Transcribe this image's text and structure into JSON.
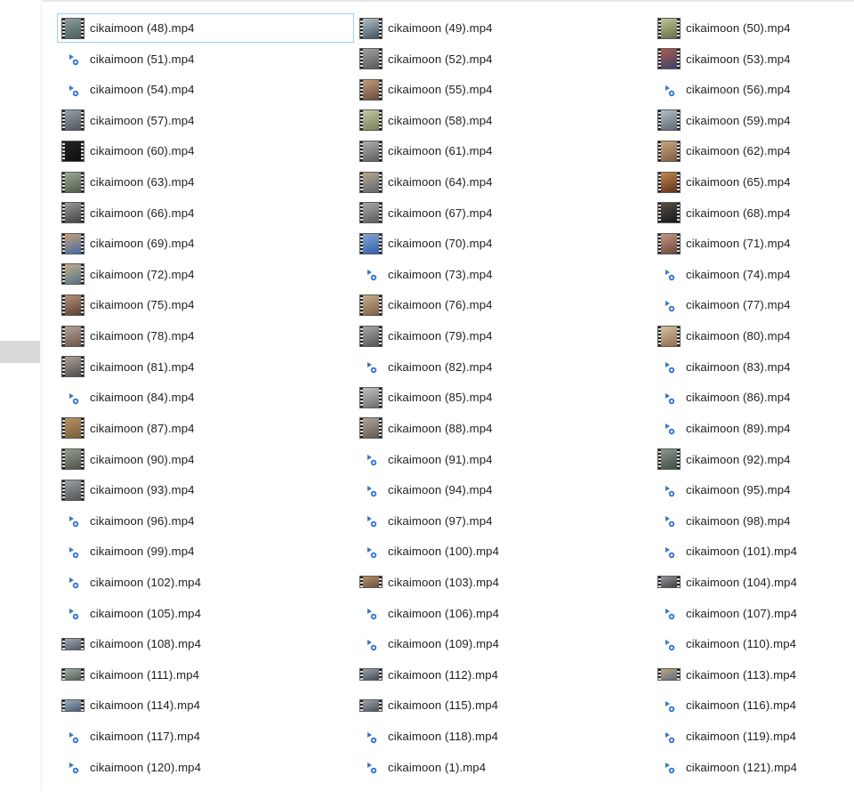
{
  "files": [
    {
      "name": "cikaimoon (48).mp4",
      "thumb": "image",
      "colors": [
        "#4a5a52",
        "#8fa0a8"
      ],
      "selected": true
    },
    {
      "name": "cikaimoon (49).mp4",
      "thumb": "image",
      "colors": [
        "#3d4e5c",
        "#b7c3c9"
      ]
    },
    {
      "name": "cikaimoon (50).mp4",
      "thumb": "image",
      "colors": [
        "#5d6b3f",
        "#c7c79a"
      ]
    },
    {
      "name": "cikaimoon (51).mp4",
      "thumb": "video-icon"
    },
    {
      "name": "cikaimoon (52).mp4",
      "thumb": "image",
      "colors": [
        "#55585b",
        "#a2a4a6"
      ]
    },
    {
      "name": "cikaimoon (53).mp4",
      "thumb": "image",
      "colors": [
        "#34446e",
        "#b05a4c"
      ]
    },
    {
      "name": "cikaimoon (54).mp4",
      "thumb": "video-icon"
    },
    {
      "name": "cikaimoon (55).mp4",
      "thumb": "image",
      "colors": [
        "#6a4a3a",
        "#c29c7d"
      ]
    },
    {
      "name": "cikaimoon (56).mp4",
      "thumb": "video-icon"
    },
    {
      "name": "cikaimoon (57).mp4",
      "thumb": "image",
      "colors": [
        "#4d5359",
        "#9aa3ab"
      ]
    },
    {
      "name": "cikaimoon (58).mp4",
      "thumb": "image",
      "colors": [
        "#76805a",
        "#c4c9a4"
      ]
    },
    {
      "name": "cikaimoon (59).mp4",
      "thumb": "image",
      "colors": [
        "#59646e",
        "#b8c2ca"
      ]
    },
    {
      "name": "cikaimoon (60).mp4",
      "thumb": "image",
      "colors": [
        "#0e0e0e",
        "#242424"
      ]
    },
    {
      "name": "cikaimoon (61).mp4",
      "thumb": "image",
      "colors": [
        "#5c5c5c",
        "#b1b1b1"
      ]
    },
    {
      "name": "cikaimoon (62).mp4",
      "thumb": "image",
      "colors": [
        "#7b5b3f",
        "#caa97f"
      ]
    },
    {
      "name": "cikaimoon (63).mp4",
      "thumb": "image",
      "colors": [
        "#4c5b4a",
        "#9eab98"
      ]
    },
    {
      "name": "cikaimoon (64).mp4",
      "thumb": "image",
      "colors": [
        "#5e6470",
        "#b7aa8f"
      ]
    },
    {
      "name": "cikaimoon (65).mp4",
      "thumb": "image",
      "colors": [
        "#5a2f1e",
        "#c48a4d"
      ]
    },
    {
      "name": "cikaimoon (66).mp4",
      "thumb": "image",
      "colors": [
        "#3d4040",
        "#9a9d9b"
      ]
    },
    {
      "name": "cikaimoon (67).mp4",
      "thumb": "image",
      "colors": [
        "#595959",
        "#a9abad"
      ]
    },
    {
      "name": "cikaimoon (68).mp4",
      "thumb": "image",
      "colors": [
        "#151515",
        "#595147"
      ]
    },
    {
      "name": "cikaimoon (69).mp4",
      "thumb": "image",
      "colors": [
        "#3f6aa6",
        "#caa277"
      ]
    },
    {
      "name": "cikaimoon (70).mp4",
      "thumb": "image",
      "colors": [
        "#2f5ea8",
        "#86a7d1"
      ]
    },
    {
      "name": "cikaimoon (71).mp4",
      "thumb": "image",
      "colors": [
        "#6a4438",
        "#c89a86"
      ]
    },
    {
      "name": "cikaimoon (72).mp4",
      "thumb": "image",
      "colors": [
        "#536f88",
        "#c4b18a"
      ]
    },
    {
      "name": "cikaimoon (73).mp4",
      "thumb": "video-icon"
    },
    {
      "name": "cikaimoon (74).mp4",
      "thumb": "video-icon"
    },
    {
      "name": "cikaimoon (75).mp4",
      "thumb": "image",
      "colors": [
        "#5a3c30",
        "#b69480"
      ]
    },
    {
      "name": "cikaimoon (76).mp4",
      "thumb": "image",
      "colors": [
        "#7c6048",
        "#c9ae8c"
      ]
    },
    {
      "name": "cikaimoon (77).mp4",
      "thumb": "video-icon"
    },
    {
      "name": "cikaimoon (78).mp4",
      "thumb": "image",
      "colors": [
        "#6a5348",
        "#b7a49a"
      ]
    },
    {
      "name": "cikaimoon (79).mp4",
      "thumb": "image",
      "colors": [
        "#4f5153",
        "#a8aaab"
      ]
    },
    {
      "name": "cikaimoon (80).mp4",
      "thumb": "image",
      "colors": [
        "#8c6b4a",
        "#d9c3a2"
      ]
    },
    {
      "name": "cikaimoon (81).mp4",
      "thumb": "image",
      "colors": [
        "#514944",
        "#aca39c"
      ]
    },
    {
      "name": "cikaimoon (82).mp4",
      "thumb": "video-icon"
    },
    {
      "name": "cikaimoon (83).mp4",
      "thumb": "video-icon"
    },
    {
      "name": "cikaimoon (84).mp4",
      "thumb": "video-icon"
    },
    {
      "name": "cikaimoon (85).mp4",
      "thumb": "image",
      "colors": [
        "#6b6c6a",
        "#c3c3bd"
      ]
    },
    {
      "name": "cikaimoon (86).mp4",
      "thumb": "video-icon"
    },
    {
      "name": "cikaimoon (87).mp4",
      "thumb": "image",
      "colors": [
        "#7a5a34",
        "#b59667"
      ]
    },
    {
      "name": "cikaimoon (88).mp4",
      "thumb": "image",
      "colors": [
        "#5f5650",
        "#b3a79c"
      ]
    },
    {
      "name": "cikaimoon (89).mp4",
      "thumb": "video-icon"
    },
    {
      "name": "cikaimoon (90).mp4",
      "thumb": "image",
      "colors": [
        "#4a4e47",
        "#9aa092"
      ]
    },
    {
      "name": "cikaimoon (91).mp4",
      "thumb": "video-icon"
    },
    {
      "name": "cikaimoon (92).mp4",
      "thumb": "image",
      "colors": [
        "#3f4a3f",
        "#8d9a8f"
      ]
    },
    {
      "name": "cikaimoon (93).mp4",
      "thumb": "image",
      "colors": [
        "#4e5052",
        "#a1a4a6"
      ]
    },
    {
      "name": "cikaimoon (94).mp4",
      "thumb": "video-icon"
    },
    {
      "name": "cikaimoon (95).mp4",
      "thumb": "video-icon"
    },
    {
      "name": "cikaimoon (96).mp4",
      "thumb": "video-icon"
    },
    {
      "name": "cikaimoon (97).mp4",
      "thumb": "video-icon"
    },
    {
      "name": "cikaimoon (98).mp4",
      "thumb": "video-icon"
    },
    {
      "name": "cikaimoon (99).mp4",
      "thumb": "video-icon"
    },
    {
      "name": "cikaimoon (100).mp4",
      "thumb": "video-icon"
    },
    {
      "name": "cikaimoon (101).mp4",
      "thumb": "video-icon"
    },
    {
      "name": "cikaimoon (102).mp4",
      "thumb": "video-icon"
    },
    {
      "name": "cikaimoon (103).mp4",
      "thumb": "wide-image",
      "colors": [
        "#6c4e36",
        "#b8946a"
      ]
    },
    {
      "name": "cikaimoon (104).mp4",
      "thumb": "wide-image",
      "colors": [
        "#3a3a3a",
        "#9a9ea2"
      ]
    },
    {
      "name": "cikaimoon (105).mp4",
      "thumb": "video-icon"
    },
    {
      "name": "cikaimoon (106).mp4",
      "thumb": "video-icon"
    },
    {
      "name": "cikaimoon (107).mp4",
      "thumb": "video-icon"
    },
    {
      "name": "cikaimoon (108).mp4",
      "thumb": "wide-image",
      "colors": [
        "#4d5761",
        "#a4adb5"
      ]
    },
    {
      "name": "cikaimoon (109).mp4",
      "thumb": "video-icon"
    },
    {
      "name": "cikaimoon (110).mp4",
      "thumb": "video-icon"
    },
    {
      "name": "cikaimoon (111).mp4",
      "thumb": "wide-image",
      "colors": [
        "#4d5a52",
        "#a6b0a8"
      ]
    },
    {
      "name": "cikaimoon (112).mp4",
      "thumb": "wide-image",
      "colors": [
        "#3f4650",
        "#9ea6b0"
      ]
    },
    {
      "name": "cikaimoon (113).mp4",
      "thumb": "wide-image",
      "colors": [
        "#5a6a7a",
        "#c2aa86"
      ]
    },
    {
      "name": "cikaimoon (114).mp4",
      "thumb": "wide-image",
      "colors": [
        "#405468",
        "#a4b3c1"
      ]
    },
    {
      "name": "cikaimoon (115).mp4",
      "thumb": "wide-image",
      "colors": [
        "#4a4f55",
        "#a0a6ac"
      ]
    },
    {
      "name": "cikaimoon (116).mp4",
      "thumb": "video-icon"
    },
    {
      "name": "cikaimoon (117).mp4",
      "thumb": "video-icon"
    },
    {
      "name": "cikaimoon (118).mp4",
      "thumb": "video-icon"
    },
    {
      "name": "cikaimoon (119).mp4",
      "thumb": "video-icon"
    },
    {
      "name": "cikaimoon (120).mp4",
      "thumb": "video-icon"
    },
    {
      "name": "cikaimoon (1).mp4",
      "thumb": "video-icon"
    },
    {
      "name": "cikaimoon (121).mp4",
      "thumb": "video-icon"
    }
  ],
  "icon_colors": {
    "play": "#3c78c8",
    "badge": "#2f6fd0",
    "doc": "#ffffff"
  }
}
